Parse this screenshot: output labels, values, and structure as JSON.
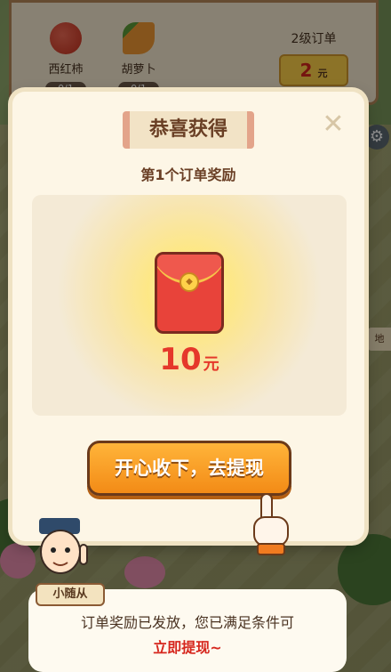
{
  "order_panel": {
    "items": [
      {
        "name": "西红柿",
        "count": "0/1",
        "icon": "tomato-icon",
        "color": "#d9402f"
      },
      {
        "name": "胡萝卜",
        "count": "0/1",
        "icon": "carrot-icon",
        "color": "#f08a25"
      }
    ],
    "order_level": "2级订单",
    "reward_value": "2",
    "reward_unit": "元"
  },
  "modal": {
    "title": "恭喜获得",
    "close_icon": "close-icon",
    "subtitle": "第1个订单奖励",
    "prize_icon": "red-envelope-icon",
    "amount": "10",
    "unit": "元",
    "claim_label": "开心收下，去提现"
  },
  "assistant": {
    "name": "小随从",
    "message_line1": "订单奖励已发放，您已满足条件可",
    "message_line2": "立即提现~"
  },
  "side": {
    "label": "地",
    "settings_icon": "gear-icon"
  },
  "colors": {
    "accent": "#f38b16",
    "highlight_red": "#e5382b",
    "envelope_red": "#e8433a",
    "panel_bg": "#fdf6e6"
  }
}
